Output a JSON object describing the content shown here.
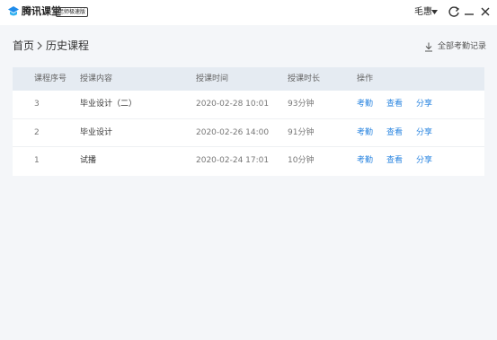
{
  "titlebar": {
    "app_title": "腾讯课堂",
    "edition_badge": "老师极速版",
    "user_name": "毛惠",
    "icons": [
      "logo-icon",
      "caret-down-icon",
      "refresh-icon",
      "minimize-icon",
      "close-icon"
    ]
  },
  "breadcrumb": {
    "home": "首页",
    "current": "历史课程"
  },
  "export": {
    "label": "全部考勤记录",
    "icon": "download-icon"
  },
  "table": {
    "columns": [
      "课程序号",
      "授课内容",
      "授课时间",
      "授课时长",
      "操作"
    ],
    "rows": [
      {
        "index": "3",
        "content": "毕业设计（二）",
        "time": "2020-02-28 10:01",
        "duration": "93分钟",
        "actions": [
          "考勤",
          "查看",
          "分享"
        ]
      },
      {
        "index": "2",
        "content": "毕业设计",
        "time": "2020-02-26 14:00",
        "duration": "91分钟",
        "actions": [
          "考勤",
          "查看",
          "分享"
        ]
      },
      {
        "index": "1",
        "content": "试播",
        "time": "2020-02-24 17:01",
        "duration": "10分钟",
        "actions": [
          "考勤",
          "查看",
          "分享"
        ]
      }
    ]
  },
  "colors": {
    "accent": "#2a85e0",
    "header_bg": "#e5ebf2",
    "page_bg": "#f4f6f9"
  }
}
